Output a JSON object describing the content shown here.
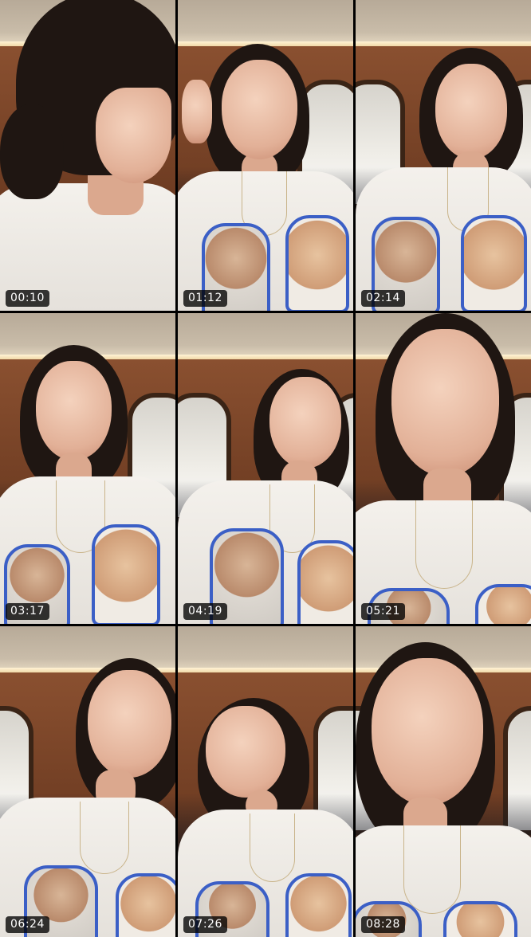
{
  "grid": {
    "tiles": [
      {
        "time": "00:10"
      },
      {
        "time": "01:12"
      },
      {
        "time": "02:14"
      },
      {
        "time": "03:17"
      },
      {
        "time": "04:19"
      },
      {
        "time": "05:21"
      },
      {
        "time": "06:24"
      },
      {
        "time": "07:26"
      },
      {
        "time": "08:28"
      }
    ]
  },
  "colors": {
    "background": "#000000",
    "badge_bg": "#000000",
    "badge_text": "#ffffff",
    "shirt_print_outline": "#3b5fc6"
  }
}
